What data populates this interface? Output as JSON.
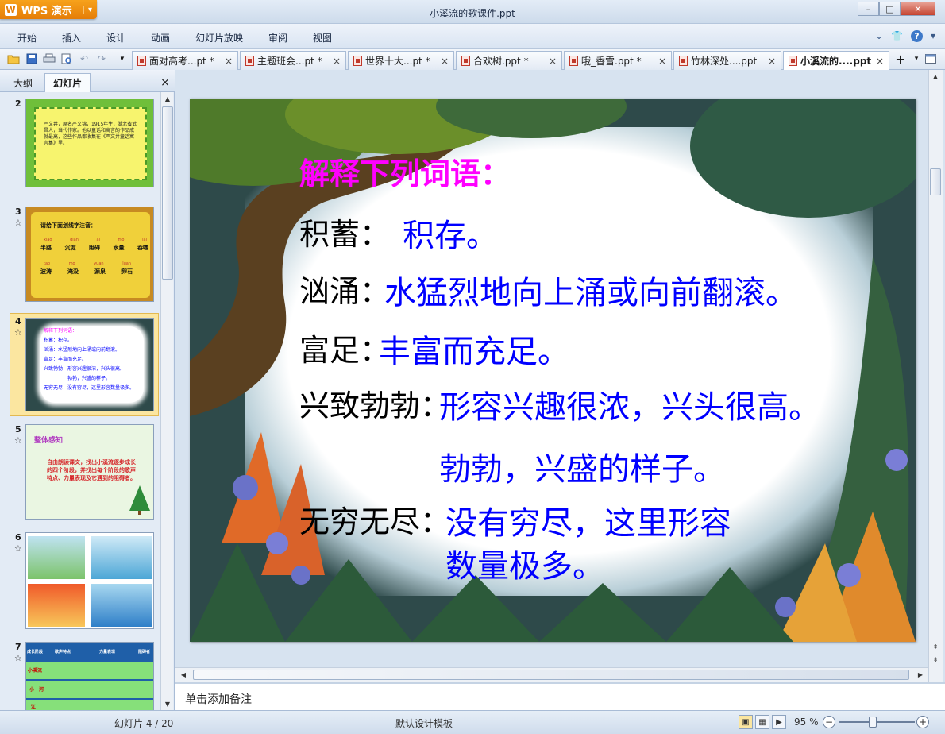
{
  "app": {
    "brand": "WPS 演示",
    "logo_letter": "W",
    "window_title": "小溪流的歌课件.ppt"
  },
  "window_controls": {
    "minimize": "–",
    "maximize": "□",
    "close": "✕"
  },
  "menu": [
    "开始",
    "插入",
    "设计",
    "动画",
    "幻灯片放映",
    "审阅",
    "视图"
  ],
  "menu_right": {
    "collapse": "⌄",
    "skin": "👕",
    "help": "?",
    "help_drop": "▾"
  },
  "tabs": [
    {
      "label": "面对高考...pt *",
      "close": "×"
    },
    {
      "label": "主题班会...pt *",
      "close": "×"
    },
    {
      "label": "世界十大...pt *",
      "close": "×"
    },
    {
      "label": "合欢树.ppt *",
      "close": "×"
    },
    {
      "label": "哦_香雪.ppt *",
      "close": "×"
    },
    {
      "label": "竹林深处....ppt",
      "close": "×"
    },
    {
      "label": "小溪流的....ppt",
      "close": "×",
      "active": true
    }
  ],
  "new_tab": "+",
  "left_panel": {
    "tab_outline": "大纲",
    "tab_slides": "幻灯片",
    "close": "×",
    "slides": [
      {
        "num": "2",
        "star": ""
      },
      {
        "num": "3",
        "star": "☆"
      },
      {
        "num": "4",
        "star": "☆"
      },
      {
        "num": "5",
        "star": "☆"
      },
      {
        "num": "6",
        "star": "☆"
      },
      {
        "num": "7",
        "star": "☆"
      }
    ],
    "thumb2_text": "严文井，原名严文锦，1915年生，湖北省武昌人，当代作家。他以童话和寓言的作品成就最高，这些作品都收集在《严文井童话寓言集》里。",
    "thumb3": {
      "title": "请给下面划线字注音：",
      "row1_pinyin": [
        "xiao",
        "dian",
        "ai",
        "mo",
        "lai"
      ],
      "row1_words": [
        "半路",
        "沉淀",
        "阻碍",
        "水量",
        "吞噬"
      ],
      "row2_pinyin": [
        "tao",
        "mo",
        "yuan",
        "luan"
      ],
      "row2_words": [
        "波涛",
        "淹没",
        "源泉",
        "卵石"
      ]
    },
    "thumb4_lines": [
      "解释下列词语：",
      "积蓄：积存。",
      "汹涌：水猛烈地向上涌或向前翻滚。",
      "富足：丰富而充足。",
      "兴致勃勃：形容兴趣很浓，兴头很高。",
      "勃勃，兴盛的样子。",
      "无穷无尽：没有穷尽，这里形容数量极多。"
    ],
    "thumb5": {
      "title": "整体感知",
      "body": "自由朗读课文，找出小溪流逐步成长的四个阶段，并找出每个阶段的歌声特点、力量表现及它遇到的阻碍者。"
    },
    "thumb7": {
      "headers": [
        "成长阶段",
        "歌声特点",
        "力量表现",
        "阻碍者"
      ],
      "rows": [
        "小溪流",
        "小　河",
        "江"
      ]
    }
  },
  "slide": {
    "heading": "解释下列词语：",
    "terms": [
      {
        "term": "积蓄：",
        "def": "积存。"
      },
      {
        "term": "汹涌：",
        "def": "水猛烈地向上涌或向前翻滚。"
      },
      {
        "term": "富足：",
        "def": "丰富而充足。"
      },
      {
        "term": "兴致勃勃：",
        "def": "形容兴趣很浓，兴头很高。"
      },
      {
        "term": "",
        "def": "勃勃，兴盛的样子。"
      },
      {
        "term": "无穷无尽：",
        "def": "没有穷尽，这里形容"
      },
      {
        "term": "",
        "def": "数量极多。"
      }
    ],
    "colors": {
      "heading": "#ff00ff",
      "term": "#000000",
      "definition": "#0000ff",
      "frame": "#2e4a4a"
    }
  },
  "notes_placeholder": "单击添加备注",
  "status": {
    "slide_counter": "幻灯片 4 / 20",
    "template": "默认设计模板",
    "zoom": "95 %",
    "zoom_out": "−",
    "zoom_in": "+"
  }
}
